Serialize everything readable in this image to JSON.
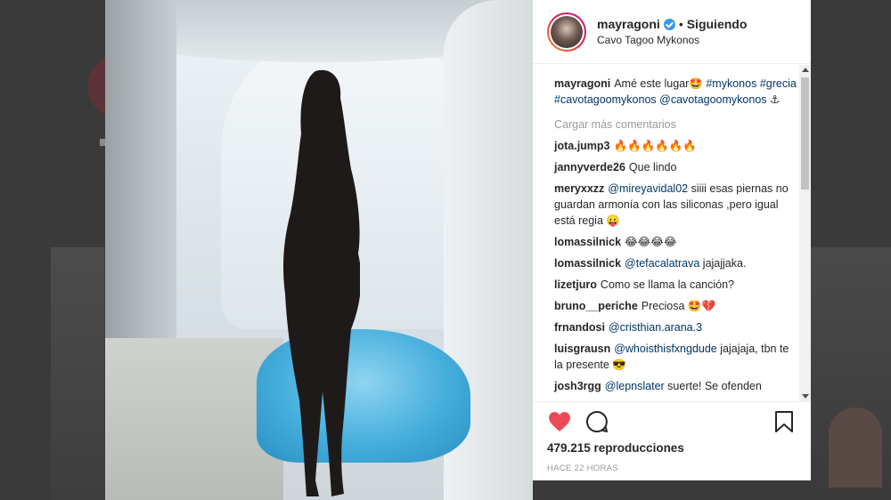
{
  "post": {
    "username": "mayragoni",
    "follow_status": "Siguiendo",
    "location": "Cavo Tagoo Mykonos",
    "caption": {
      "user": "mayragoni",
      "text": "Amé este lugar",
      "emoji": "🤩",
      "tags": [
        "#mykonos",
        "#grecia",
        "#cavotagoomykonos"
      ],
      "mention": "@cavotagoomykonos",
      "end_emoji": "⚓"
    },
    "load_more": "Cargar más comentarios",
    "comments": [
      {
        "user": "jota.jump3",
        "text": "🔥🔥🔥🔥🔥🔥"
      },
      {
        "user": "jannyverde26",
        "text": "Que lindo"
      },
      {
        "user": "meryxxzz",
        "mention": "@mireyavidal02",
        "text": " siiii esas piernas no guardan armonía con las siliconas ,pero igual está regia 😛"
      },
      {
        "user": "lomassilnick",
        "text": "😂😂😂😂"
      },
      {
        "user": "lomassilnick",
        "mention": "@tefacalatrava",
        "text": " jajajjaka."
      },
      {
        "user": "lizetjuro",
        "text": "Como se llama la canción?"
      },
      {
        "user": "bruno__periche",
        "text": "Preciosa 🤩💔"
      },
      {
        "user": "frnandosi",
        "mention": "@cristhian.arana.3",
        "text": ""
      },
      {
        "user": "luisgrausn",
        "mention": "@whoisthisfxngdude",
        "text": " jajajaja, tbn te la presente 😎"
      },
      {
        "user": "josh3rgg",
        "mention": "@lepnslater",
        "text": " suerte! Se ofenden"
      }
    ],
    "views": "479.215 reproducciones",
    "time_ago": "HACE 22 HORAS"
  },
  "icons": {
    "like": "heart-icon",
    "comment": "comment-icon",
    "save": "bookmark-icon",
    "verified": "verified-badge-icon"
  },
  "colors": {
    "like_red": "#ed4956",
    "link_blue": "#003569",
    "verified_blue": "#3897f0"
  }
}
